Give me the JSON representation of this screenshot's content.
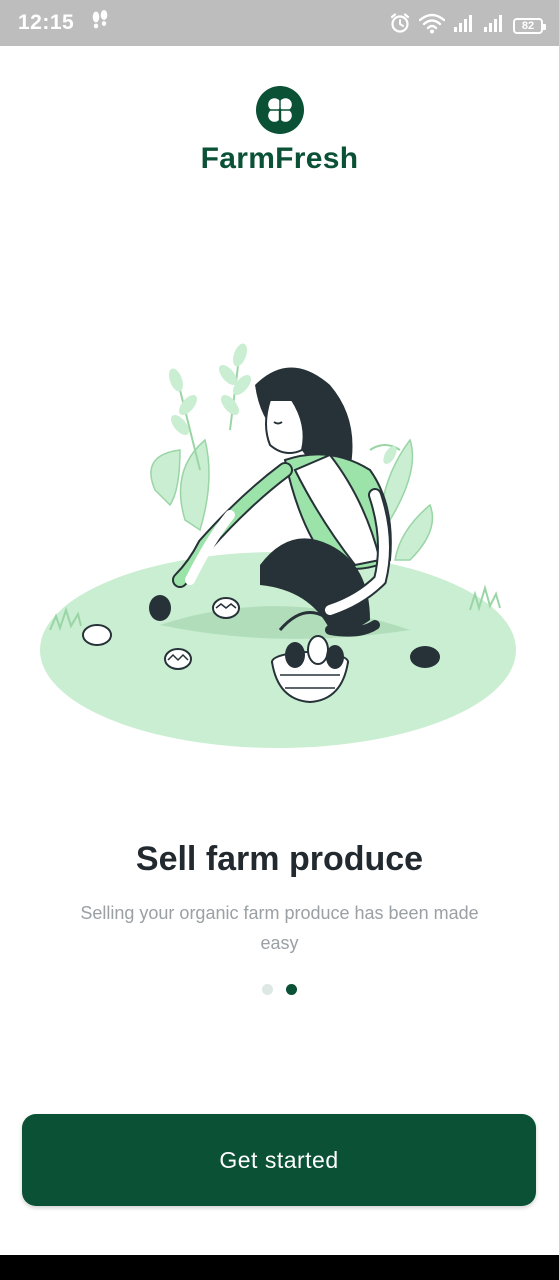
{
  "status_bar": {
    "time": "12:15",
    "battery": "82"
  },
  "app": {
    "name": "FarmFresh"
  },
  "onboarding": {
    "title": "Sell farm produce",
    "subtitle": "Selling your organic farm produce has been made easy",
    "page_count": 2,
    "active_page": 2
  },
  "cta": {
    "label": "Get started"
  },
  "colors": {
    "brand": "#0a5135",
    "status_bar_bg": "#bdbdbd",
    "grass": "#c9eed1",
    "grass_dark": "#9ad5a6"
  }
}
